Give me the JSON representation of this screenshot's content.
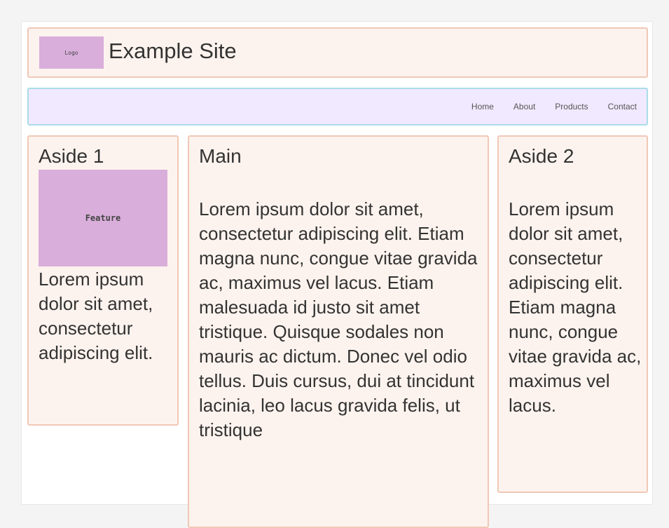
{
  "header": {
    "logo_label": "Logo",
    "site_title": "Example Site"
  },
  "nav": {
    "items": [
      {
        "label": "Home"
      },
      {
        "label": "About"
      },
      {
        "label": "Products"
      },
      {
        "label": "Contact"
      }
    ]
  },
  "aside1": {
    "title": "Aside 1",
    "feature_label": "Feature",
    "text": "Lorem ipsum dolor sit amet, consectetur adipiscing elit."
  },
  "main": {
    "title": "Main",
    "text": "Lorem ipsum dolor sit amet, consectetur adipiscing elit. Etiam magna nunc, congue vitae gravida ac, maximus vel lacus. Etiam malesuada id justo sit amet tristique. Quisque sodales non mauris ac dictum. Donec vel odio tellus. Duis cursus, dui at tincidunt lacinia, leo lacus gravida felis, ut tristique"
  },
  "aside2": {
    "title": "Aside 2",
    "text": "Lorem ipsum dolor sit amet, consectetur adipiscing elit. Etiam magna nunc, congue vitae gravida ac, maximus vel lacus."
  },
  "colors": {
    "box_background": "#fdf3ee",
    "box_border": "#f1c8b7",
    "nav_background": "#f0e9ff",
    "nav_border": "#a9dde8",
    "placeholder": "#d9aedb"
  }
}
